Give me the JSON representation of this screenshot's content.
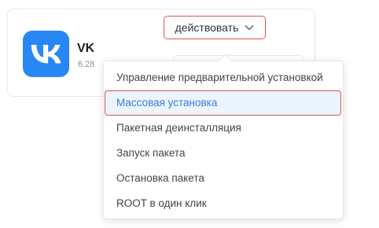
{
  "app": {
    "name": "VK",
    "version": "6.28",
    "icon": "vk-logo-icon",
    "icon_color": "#2787f5"
  },
  "action_button": {
    "label": "действовать",
    "icon": "chevron-down-icon",
    "highlight_color": "#d9534f"
  },
  "menu": {
    "items": [
      {
        "label": "Управление предварительной установкой"
      },
      {
        "label": "Массовая установка",
        "highlighted": true
      },
      {
        "label": "Пакетная деинсталляция"
      },
      {
        "label": "Запуск пакета"
      },
      {
        "label": "Остановка пакета"
      },
      {
        "label": "ROOT в один клик"
      }
    ],
    "highlight_bg": "#ecf5ff",
    "highlight_text": "#3a7bd5"
  }
}
